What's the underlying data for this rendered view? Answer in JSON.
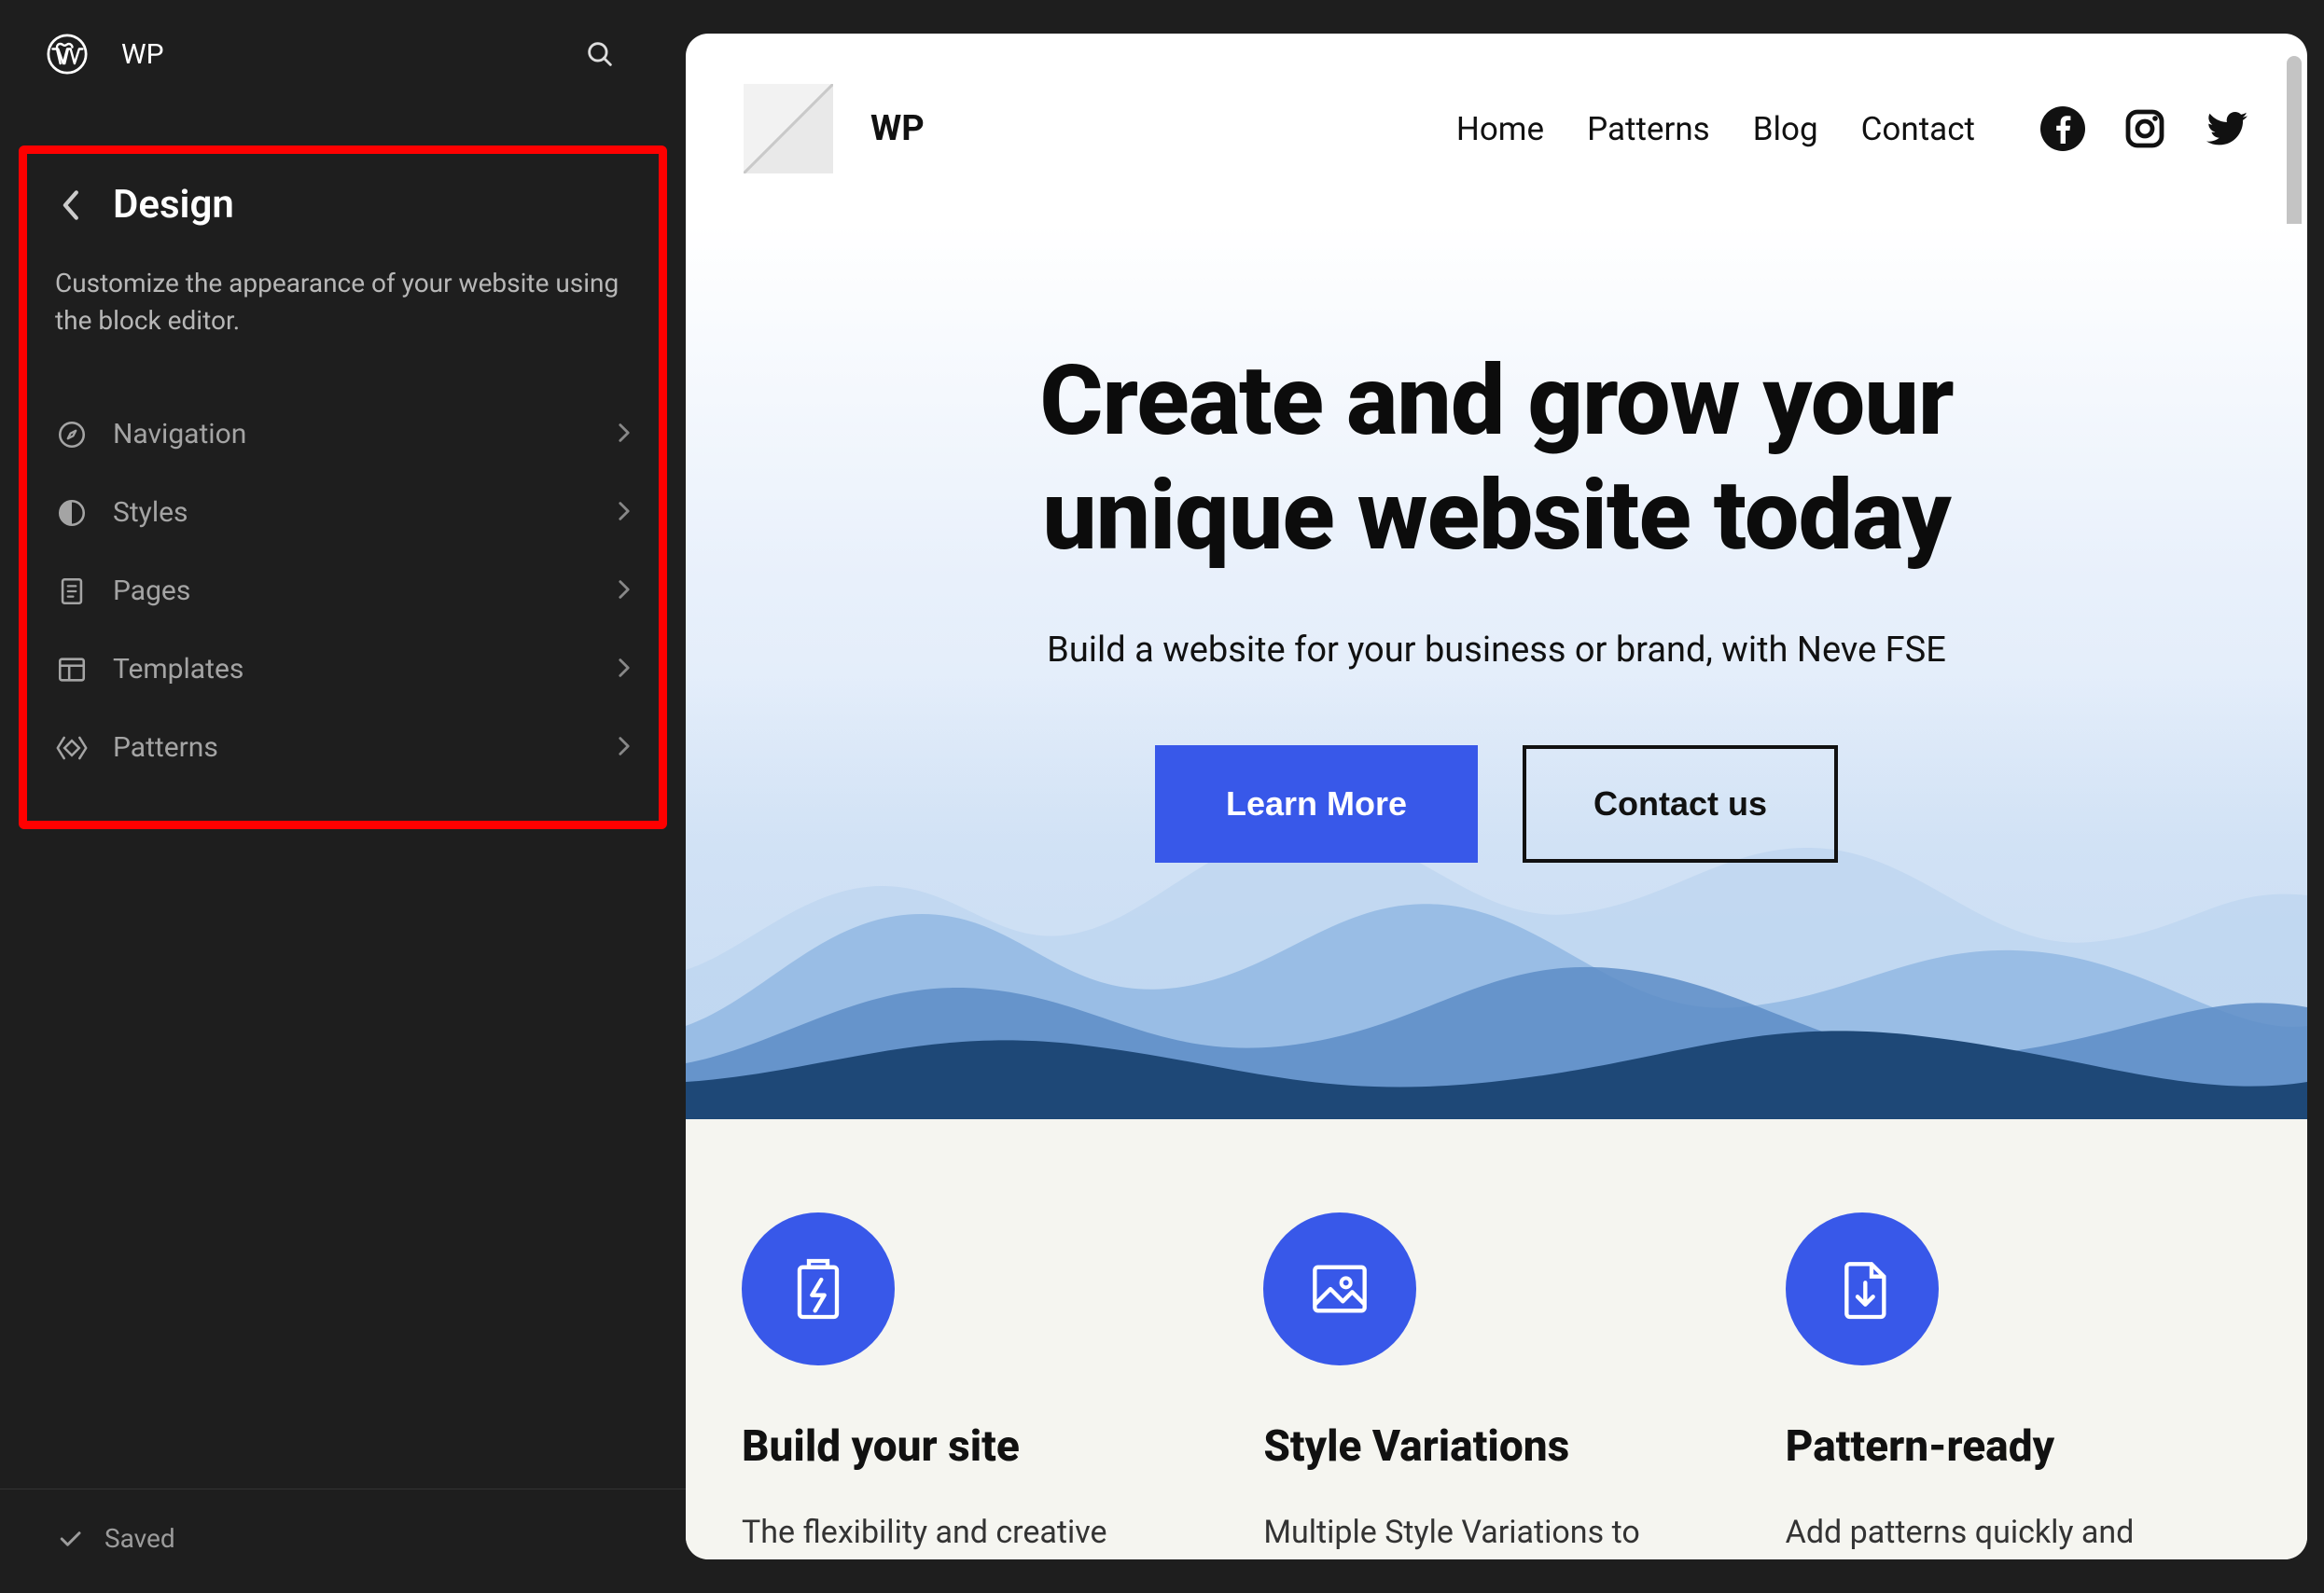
{
  "sidebar": {
    "site_name": "WP",
    "panel_title": "Design",
    "panel_desc": "Customize the appearance of your website using the block editor.",
    "menu": [
      {
        "icon": "compass-icon",
        "label": "Navigation"
      },
      {
        "icon": "contrast-icon",
        "label": "Styles"
      },
      {
        "icon": "page-icon",
        "label": "Pages"
      },
      {
        "icon": "layout-icon",
        "label": "Templates"
      },
      {
        "icon": "patterns-icon",
        "label": "Patterns"
      }
    ],
    "saved_label": "Saved"
  },
  "preview": {
    "site_title": "WP",
    "nav": [
      "Home",
      "Patterns",
      "Blog",
      "Contact"
    ],
    "hero": {
      "headline_l1": "Create and grow your",
      "headline_l2": "unique website today",
      "subhead": "Build a website for your business or brand, with Neve FSE",
      "cta_primary": "Learn More",
      "cta_secondary": "Contact us"
    },
    "features": [
      {
        "title": "Build your site",
        "desc": "The flexibility and creative"
      },
      {
        "title": "Style Variations",
        "desc": "Multiple Style Variations to"
      },
      {
        "title": "Pattern-ready",
        "desc": "Add patterns quickly and"
      }
    ]
  }
}
